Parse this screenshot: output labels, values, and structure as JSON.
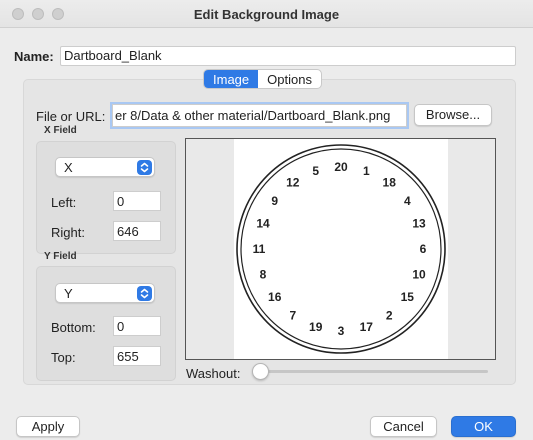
{
  "window": {
    "title": "Edit Background Image"
  },
  "name": {
    "label": "Name:",
    "value": "Dartboard_Blank"
  },
  "tabs": [
    {
      "label": "Image",
      "active": true
    },
    {
      "label": "Options",
      "active": false
    }
  ],
  "file": {
    "label": "File or URL:",
    "value": "er 8/Data & other material/Dartboard_Blank.png",
    "browse_label": "Browse..."
  },
  "x_field": {
    "section_label": "X Field",
    "selected": "X",
    "left_label": "Left:",
    "left_value": "0",
    "right_label": "Right:",
    "right_value": "646"
  },
  "y_field": {
    "section_label": "Y Field",
    "selected": "Y",
    "bottom_label": "Bottom:",
    "bottom_value": "0",
    "top_label": "Top:",
    "top_value": "655"
  },
  "preview": {
    "dartboard_numbers": [
      "20",
      "1",
      "18",
      "4",
      "13",
      "6",
      "10",
      "15",
      "2",
      "17",
      "3",
      "19",
      "7",
      "16",
      "8",
      "11",
      "14",
      "9",
      "12",
      "5"
    ]
  },
  "washout": {
    "label": "Washout:",
    "value": 0
  },
  "buttons": {
    "apply": "Apply",
    "cancel": "Cancel",
    "ok": "OK"
  },
  "colors": {
    "accent": "#2f7ae5"
  }
}
